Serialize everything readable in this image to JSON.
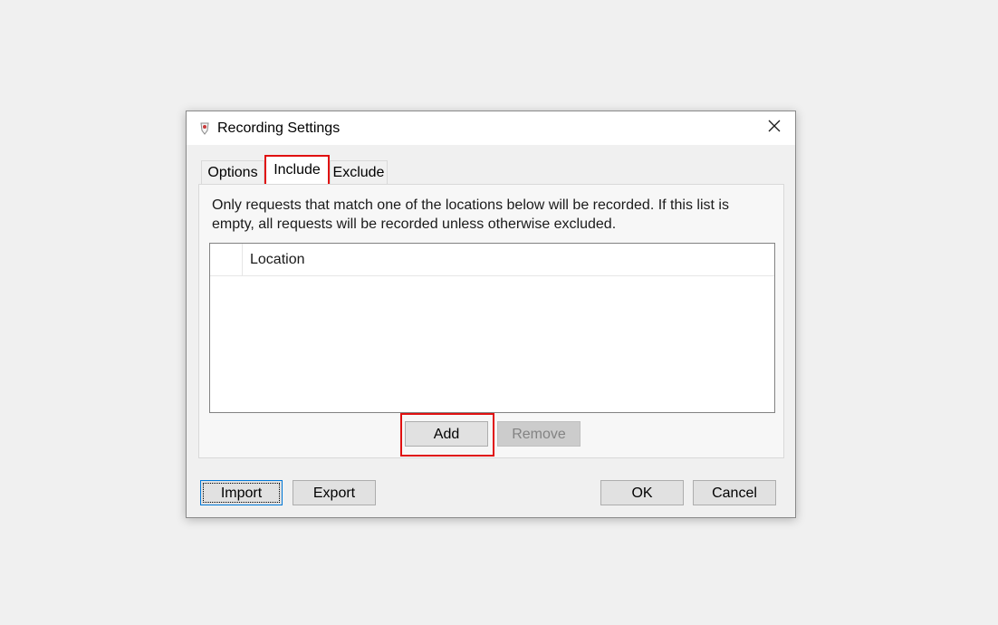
{
  "window": {
    "title": "Recording Settings",
    "close_glyph": "✕"
  },
  "tabs": [
    {
      "label": "Options",
      "selected": false
    },
    {
      "label": "Include",
      "selected": true
    },
    {
      "label": "Exclude",
      "selected": false
    }
  ],
  "include_panel": {
    "description": "Only requests that match one of the locations below will be recorded. If this list is empty, all requests will be recorded unless otherwise excluded.",
    "list": {
      "columns": [
        "",
        "Location"
      ],
      "rows": []
    },
    "add_label": "Add",
    "remove_label": "Remove"
  },
  "footer": {
    "import_label": "Import",
    "export_label": "Export",
    "ok_label": "OK",
    "cancel_label": "Cancel"
  },
  "colors": {
    "highlight": "#e01010",
    "focus": "#0078d7"
  },
  "icons": {
    "app": "recorder-app-icon",
    "close": "close-icon"
  }
}
